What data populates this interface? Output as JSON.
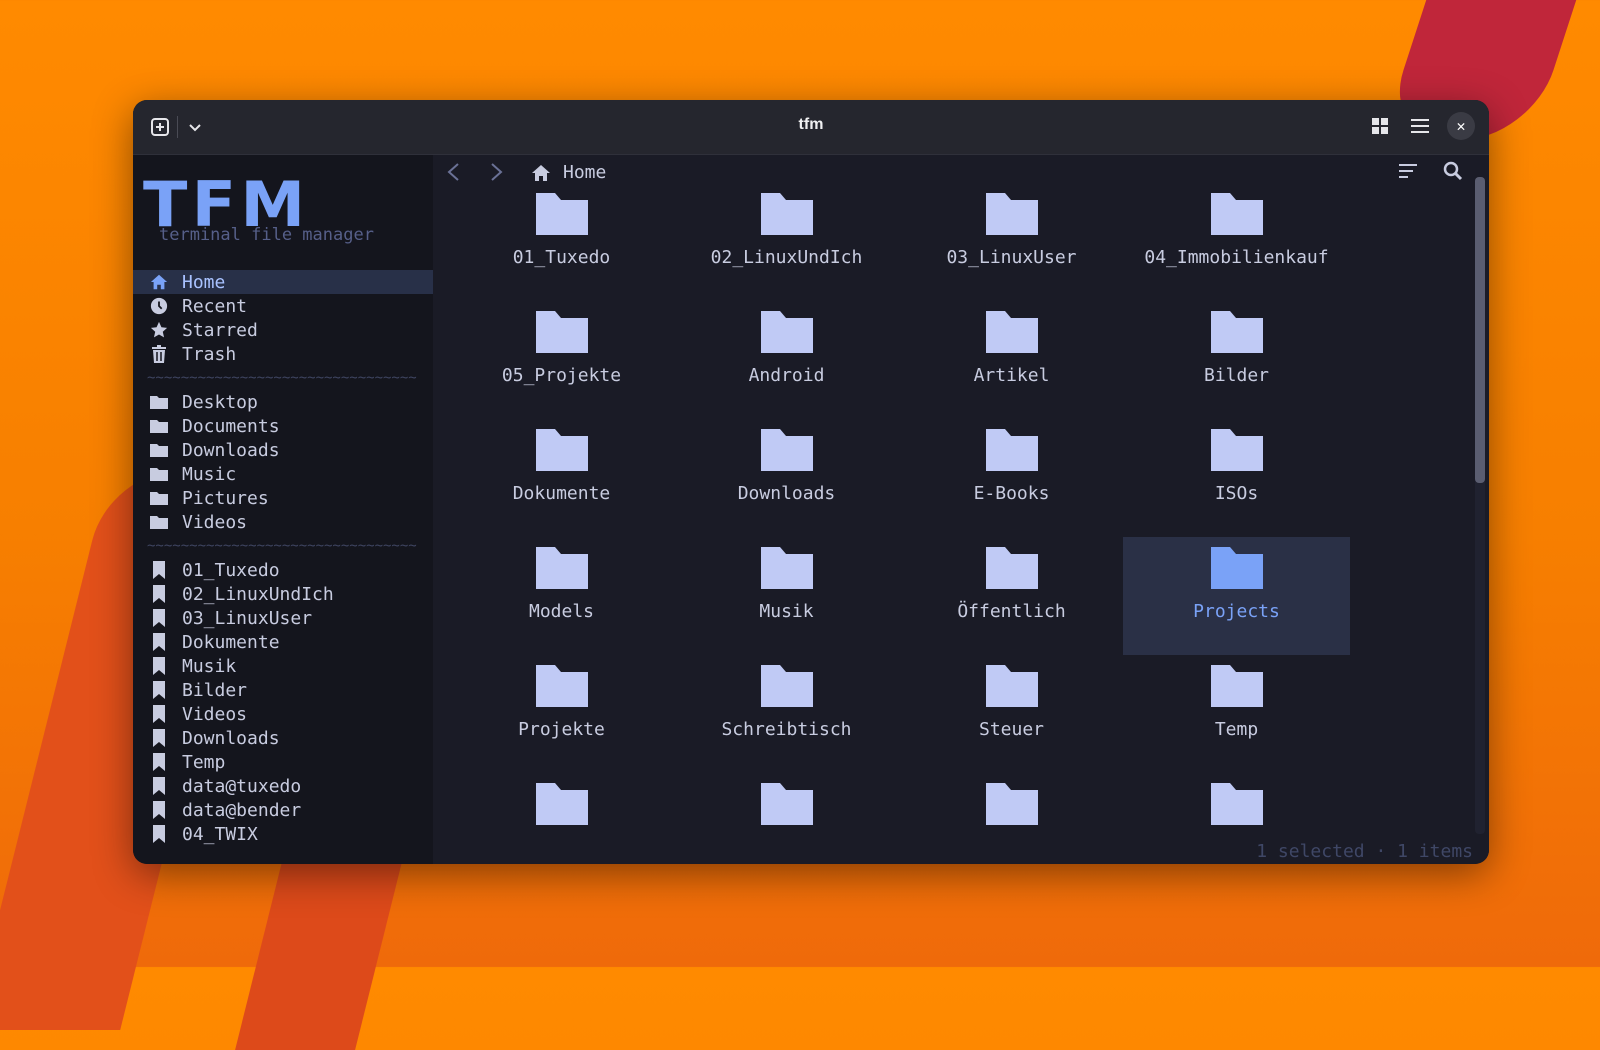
{
  "window": {
    "title": "tfm",
    "new_tab_icon": "new-tab-icon",
    "menu_icon": "chevron-down-icon",
    "grid_view_icon": "grid-view-icon",
    "list_view_icon": "list-view-icon",
    "close_label": "✕"
  },
  "sidebar": {
    "logo": "TFM",
    "tagline": "terminal file manager",
    "places": [
      {
        "label": "Home",
        "icon": "home-icon",
        "active": true
      },
      {
        "label": "Recent",
        "icon": "clock-icon"
      },
      {
        "label": "Starred",
        "icon": "star-icon"
      },
      {
        "label": "Trash",
        "icon": "trash-icon"
      }
    ],
    "separator": "~~~~~~~~~~~~~~~~~~~~~~~~~~~~~~~~",
    "folders": [
      {
        "label": "Desktop",
        "icon": "folder-icon"
      },
      {
        "label": "Documents",
        "icon": "folder-icon"
      },
      {
        "label": "Downloads",
        "icon": "folder-icon"
      },
      {
        "label": "Music",
        "icon": "folder-icon"
      },
      {
        "label": "Pictures",
        "icon": "folder-icon"
      },
      {
        "label": "Videos",
        "icon": "folder-icon"
      }
    ],
    "bookmarks": [
      {
        "label": "01_Tuxedo",
        "icon": "bookmark-icon"
      },
      {
        "label": "02_LinuxUndIch",
        "icon": "bookmark-icon"
      },
      {
        "label": "03_LinuxUser",
        "icon": "bookmark-icon"
      },
      {
        "label": "Dokumente",
        "icon": "bookmark-icon"
      },
      {
        "label": "Musik",
        "icon": "bookmark-icon"
      },
      {
        "label": "Bilder",
        "icon": "bookmark-icon"
      },
      {
        "label": "Videos",
        "icon": "bookmark-icon"
      },
      {
        "label": "Downloads",
        "icon": "bookmark-icon"
      },
      {
        "label": "Temp",
        "icon": "bookmark-icon"
      },
      {
        "label": "data@tuxedo",
        "icon": "bookmark-icon"
      },
      {
        "label": "data@bender",
        "icon": "bookmark-icon"
      },
      {
        "label": "04_TWIX",
        "icon": "bookmark-icon"
      }
    ]
  },
  "pathbar": {
    "back_icon": "back-icon",
    "forward_icon": "forward-icon",
    "location": "Home",
    "sort_icon": "sort-icon",
    "search_icon": "search-icon"
  },
  "files": [
    {
      "name": "01_Tuxedo"
    },
    {
      "name": "02_LinuxUndIch"
    },
    {
      "name": "03_LinuxUser"
    },
    {
      "name": "04_Immobilienkauf"
    },
    {
      "name": "05_Projekte"
    },
    {
      "name": "Android"
    },
    {
      "name": "Artikel"
    },
    {
      "name": "Bilder"
    },
    {
      "name": "Dokumente"
    },
    {
      "name": "Downloads"
    },
    {
      "name": "E-Books"
    },
    {
      "name": "ISOs"
    },
    {
      "name": "Models"
    },
    {
      "name": "Musik"
    },
    {
      "name": "Öffentlich"
    },
    {
      "name": "Projects",
      "selected": true
    },
    {
      "name": "Projekte"
    },
    {
      "name": "Schreibtisch"
    },
    {
      "name": "Steuer"
    },
    {
      "name": "Temp"
    },
    {
      "name": ""
    },
    {
      "name": ""
    },
    {
      "name": ""
    },
    {
      "name": ""
    }
  ],
  "status": "1 selected · 1 items",
  "colors": {
    "accent": "#7aa2f7",
    "folder": "#c0caf5",
    "background": "#1a1b26",
    "sidebar": "#14151d"
  }
}
